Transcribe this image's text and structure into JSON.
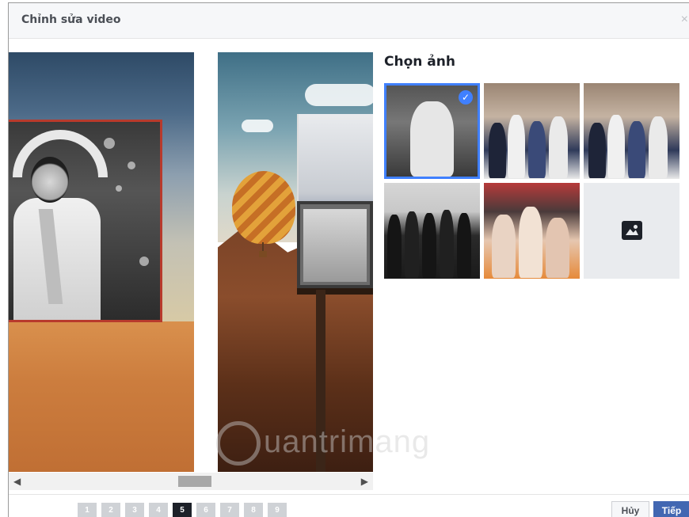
{
  "dialog": {
    "title": "Chỉnh sửa video",
    "close_label": "×"
  },
  "panel": {
    "title": "Chọn ảnh",
    "photos": [
      {
        "name": "photo-1",
        "selected": true,
        "check": "✓"
      },
      {
        "name": "photo-2",
        "selected": false
      },
      {
        "name": "photo-3",
        "selected": false
      },
      {
        "name": "photo-4",
        "selected": false
      },
      {
        "name": "photo-5",
        "selected": false
      },
      {
        "name": "upload",
        "icon": "photo-icon"
      }
    ]
  },
  "scroll": {
    "left_arrow": "◀",
    "right_arrow": "▶"
  },
  "pager": {
    "pages": [
      "1",
      "2",
      "3",
      "4",
      "5",
      "6",
      "7",
      "8",
      "9"
    ],
    "active_page": "5"
  },
  "footer": {
    "cancel_label": "Hủy",
    "next_label": "Tiếp"
  },
  "watermark": {
    "text": "uantrimang"
  },
  "colors": {
    "accent": "#4080ff",
    "primary_button": "#4267b2",
    "frame_red": "#b83a2c"
  }
}
